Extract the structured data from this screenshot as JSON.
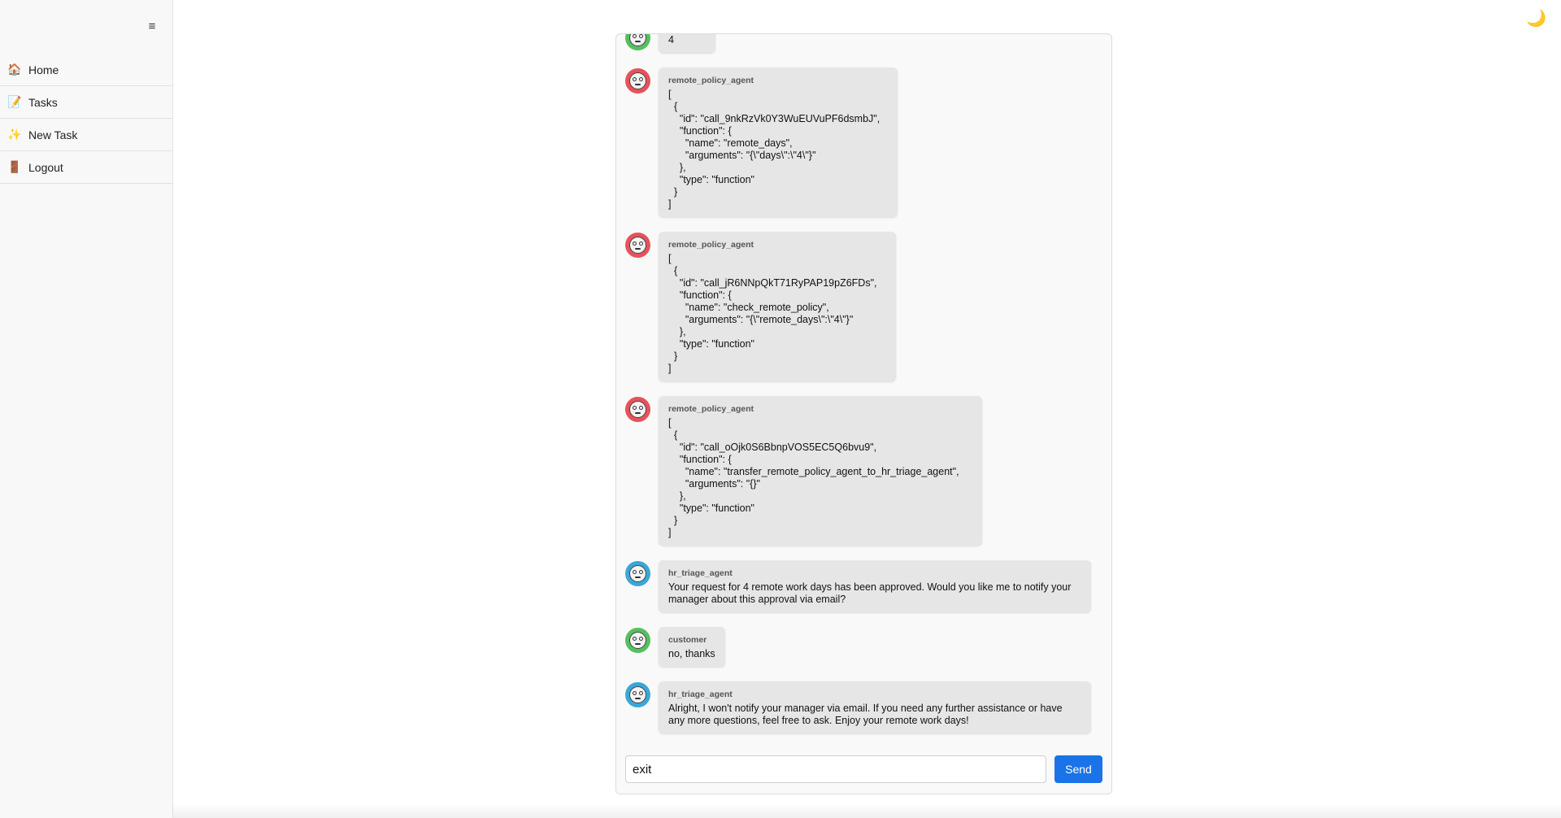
{
  "sidebar": {
    "toggle_icon": "≡",
    "items": [
      {
        "icon": "🏠",
        "icon_name": "home-icon",
        "label": "Home"
      },
      {
        "icon": "📝",
        "icon_name": "memo-icon",
        "label": "Tasks"
      },
      {
        "icon": "✨",
        "icon_name": "sparkles-icon",
        "label": "New Task"
      },
      {
        "icon": "🚪",
        "icon_name": "door-icon",
        "label": "Logout"
      }
    ]
  },
  "theme_toggle": {
    "icon": "🌙",
    "icon_name": "moon-icon"
  },
  "chat": {
    "messages": [
      {
        "sender": "",
        "avatar_color": "green",
        "text": "4"
      },
      {
        "sender": "remote_policy_agent",
        "avatar_color": "red",
        "text": "[\n  {\n    \"id\": \"call_9nkRzVk0Y3WuEUVuPF6dsmbJ\",\n    \"function\": {\n      \"name\": \"remote_days\",\n      \"arguments\": \"{\\\"days\\\":\\\"4\\\"}\"\n    },\n    \"type\": \"function\"\n  }\n]"
      },
      {
        "sender": "remote_policy_agent",
        "avatar_color": "red",
        "text": "[\n  {\n    \"id\": \"call_jR6NNpQkT71RyPAP19pZ6FDs\",\n    \"function\": {\n      \"name\": \"check_remote_policy\",\n      \"arguments\": \"{\\\"remote_days\\\":\\\"4\\\"}\"\n    },\n    \"type\": \"function\"\n  }\n]"
      },
      {
        "sender": "remote_policy_agent",
        "avatar_color": "red",
        "text": "[\n  {\n    \"id\": \"call_oOjk0S6BbnpVOS5EC5Q6bvu9\",\n    \"function\": {\n      \"name\": \"transfer_remote_policy_agent_to_hr_triage_agent\",\n      \"arguments\": \"{}\"\n    },\n    \"type\": \"function\"\n  }\n]"
      },
      {
        "sender": "hr_triage_agent",
        "avatar_color": "blue",
        "text": "Your request for 4 remote work days has been approved. Would you like me to notify your manager about this approval via email?"
      },
      {
        "sender": "customer",
        "avatar_color": "green",
        "text": "no, thanks"
      },
      {
        "sender": "hr_triage_agent",
        "avatar_color": "blue",
        "text": "Alright, I won't notify your manager via email. If you need any further assistance or have any more questions, feel free to ask. Enjoy your remote work days!"
      }
    ],
    "input": {
      "value": "exit",
      "placeholder": ""
    },
    "send_label": "Send"
  },
  "colors": {
    "accent": "#1a73e8",
    "avatar_red": "#e7525a",
    "avatar_blue": "#3aa7d8",
    "avatar_green": "#55c05e",
    "bubble": "#e6e6e6"
  }
}
